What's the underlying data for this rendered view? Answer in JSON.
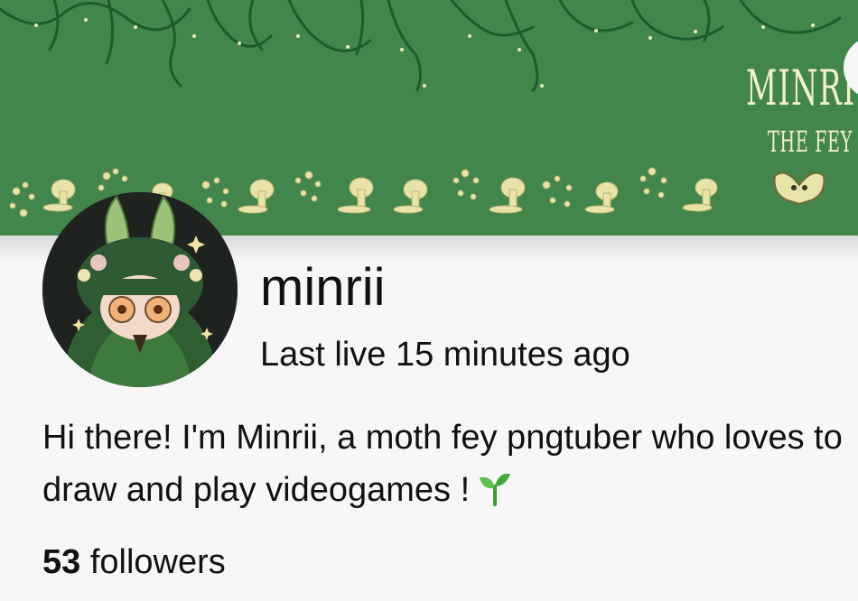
{
  "banner": {
    "title": "MINRI",
    "subtitle": "THE FEY",
    "background_color": "#43864b",
    "accent_color": "#f3f1c9"
  },
  "profile": {
    "display_name": "minrii",
    "last_live": "Last live 15 minutes ago",
    "bio": "Hi there! I'm Minrii, a moth fey pngtuber who loves to draw and play videogames !",
    "bio_emoji": "sprout-icon",
    "followers_count": "53",
    "followers_label": "followers"
  }
}
